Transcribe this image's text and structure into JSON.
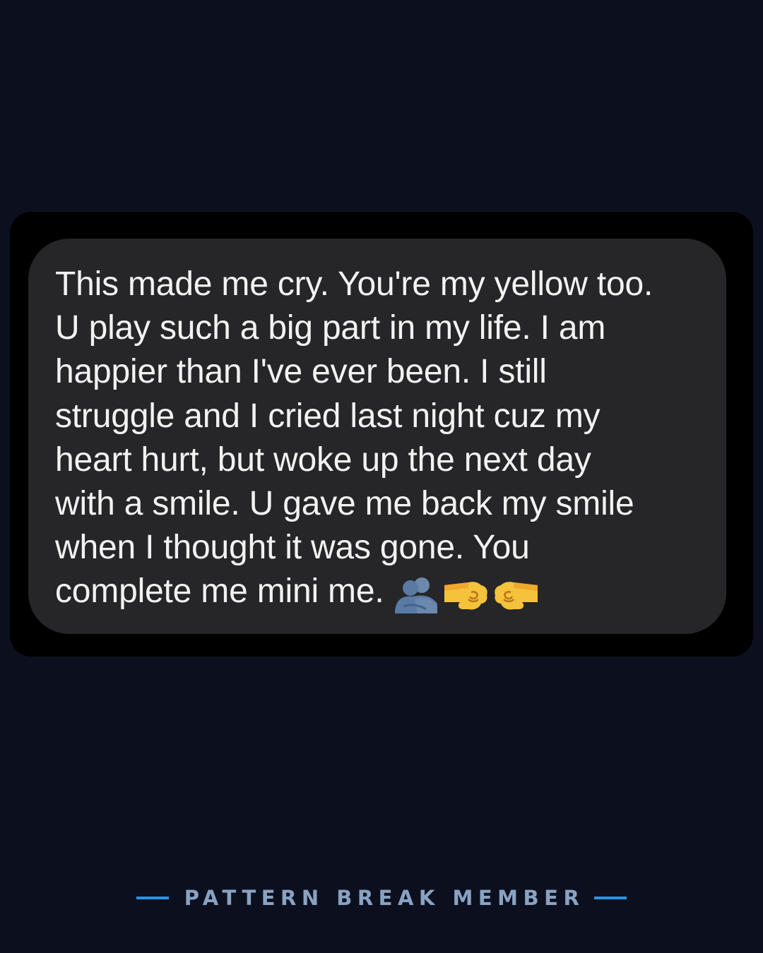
{
  "message": {
    "text": "This made me cry. You're my yellow too.\nU play such a big part in my life. I am\nhappier than I've ever been. I still\nstruggle and I cried last night cuz my\nheart hurt, but woke up the next day\nwith a smile. U gave me back my smile\nwhen I thought it was gone. You\ncomplete me mini me.",
    "emojis": [
      "people-hugging-icon",
      "left-facing-fist-icon",
      "right-facing-fist-icon"
    ]
  },
  "footer": {
    "label": "PATTERN BREAK MEMBER"
  },
  "colors": {
    "page_background": "#0c101e",
    "frame_background": "#000000",
    "bubble_background": "#262628",
    "message_text": "#f2f2f2",
    "footer_text": "#8aa2c2",
    "footer_accent": "#2a93e6"
  }
}
